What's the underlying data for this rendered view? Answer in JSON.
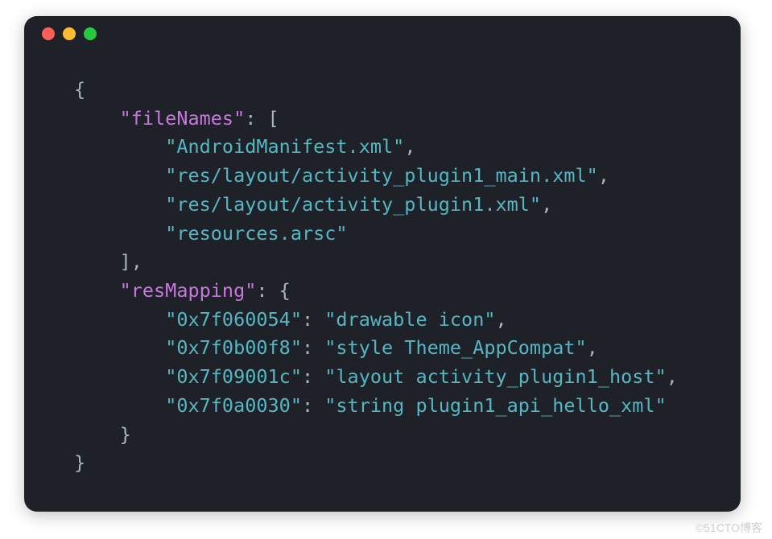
{
  "code": {
    "keys": {
      "fileNames": "\"fileNames\"",
      "resMapping": "\"resMapping\""
    },
    "fileNames": [
      "\"AndroidManifest.xml\"",
      "\"res/layout/activity_plugin1_main.xml\"",
      "\"res/layout/activity_plugin1.xml\"",
      "\"resources.arsc\""
    ],
    "resMapping": {
      "k0": "\"0x7f060054\"",
      "v0": "\"drawable icon\"",
      "k1": "\"0x7f0b00f8\"",
      "v1": "\"style Theme_AppCompat\"",
      "k2": "\"0x7f09001c\"",
      "v2": "\"layout activity_plugin1_host\"",
      "k3": "\"0x7f0a0030\"",
      "v3": "\"string plugin1_api_hello_xml\""
    }
  },
  "watermark": "©51CTO博客"
}
